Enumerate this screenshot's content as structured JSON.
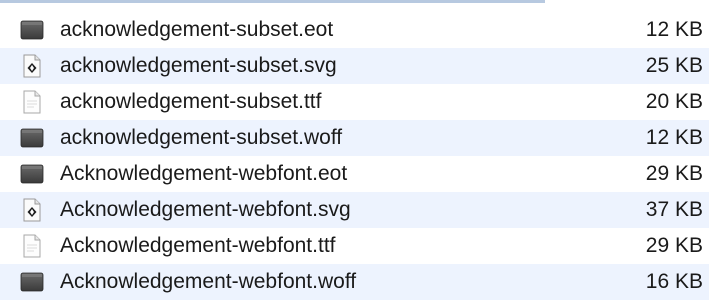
{
  "files": [
    {
      "name": "acknowledgement-subset.eot",
      "size": "12 KB",
      "icon": "dark-document-icon"
    },
    {
      "name": "acknowledgement-subset.svg",
      "size": "25 KB",
      "icon": "svg-document-icon"
    },
    {
      "name": "acknowledgement-subset.ttf",
      "size": "20 KB",
      "icon": "blank-document-icon"
    },
    {
      "name": "acknowledgement-subset.woff",
      "size": "12 KB",
      "icon": "dark-document-icon"
    },
    {
      "name": "Acknowledgement-webfont.eot",
      "size": "29 KB",
      "icon": "dark-document-icon"
    },
    {
      "name": "Acknowledgement-webfont.svg",
      "size": "37 KB",
      "icon": "svg-document-icon"
    },
    {
      "name": "Acknowledgement-webfont.ttf",
      "size": "29 KB",
      "icon": "blank-document-icon"
    },
    {
      "name": "Acknowledgement-webfont.woff",
      "size": "16 KB",
      "icon": "dark-document-icon"
    }
  ]
}
